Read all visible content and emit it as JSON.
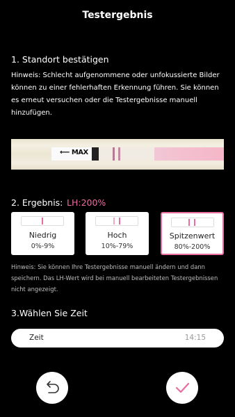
{
  "header": {
    "title": "Testergebnis"
  },
  "step1": {
    "title": "1. Standort bestätigen",
    "hint": "Hinweis: Schlecht aufgenommene oder unfokussierte Bilder können zu einer fehlerhaften Erkennung führen. Sie können es erneut versuchen oder die Testergebnisse manuell hinzufügen."
  },
  "strip": {
    "max_label": "MAX"
  },
  "step2": {
    "title": "2. Ergebnis:",
    "value": "LH:200%",
    "cards": [
      {
        "name": "Niedrig",
        "range": "0%-9%"
      },
      {
        "name": "Hoch",
        "range": "10%-79%"
      },
      {
        "name": "Spitzenwert",
        "range": "80%-200%"
      }
    ],
    "hint": "Hinweis: Sie können Ihre Testergebnisse manuell ändern und dann speichern. Das LH-Wert wird bei manuell bearbeiteten Testergebnissen nicht angezeigt."
  },
  "step3": {
    "title": "3.Wählen Sie Zeit",
    "time_label": "Zeit",
    "time_value": "14:15"
  },
  "colors": {
    "accent": "#e76ea0",
    "background": "#000000"
  }
}
